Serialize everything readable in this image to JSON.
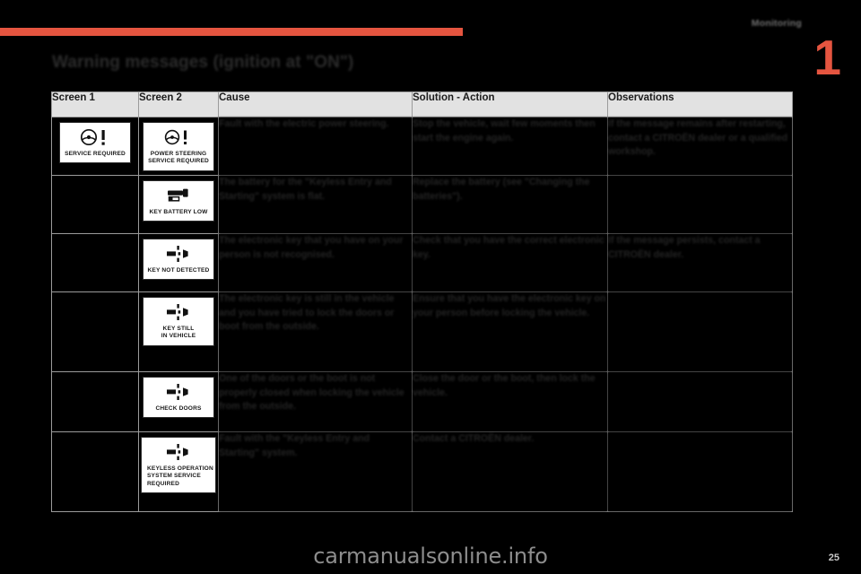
{
  "document": {
    "chapter_number": "1",
    "chapter_tab_label": "Monitoring",
    "section_title": "Warning messages (ignition at \"ON\")",
    "page_number": "25",
    "watermark": "carmanualsonline.info",
    "accent_color": "#e55540"
  },
  "table": {
    "headers": [
      "Screen 1",
      "Screen 2",
      "Cause",
      "Solution - Action",
      "Observations"
    ],
    "rows": [
      {
        "screen1": {
          "icon": "steering-wheel-warning-icon",
          "caption": "SERVICE REQUIRED"
        },
        "screen2": {
          "icon": "steering-wheel-warning-icon",
          "caption": "POWER STEERING\nSERVICE REQUIRED"
        },
        "cause": "Fault with the electric power steering.",
        "solution": "Stop the vehicle, wait few moments then start the engine again.",
        "observations": "If the message remains after restarting, contact a CITROËN dealer or a qualified workshop."
      },
      {
        "screen1": null,
        "screen2": {
          "icon": "key-battery-icon",
          "caption": "KEY BATTERY LOW"
        },
        "cause": "The battery for the \"Keyless Entry and Starting\" system is flat.",
        "solution": "Replace the battery (see \"Changing the batteries\").",
        "observations": ""
      },
      {
        "screen1": null,
        "screen2": {
          "icon": "key-not-detected-icon",
          "caption": "KEY NOT DETECTED"
        },
        "cause": "The electronic key that you have on your person is not recognised.",
        "solution": "Check that you have the correct electronic key.",
        "observations": "If the message persists, contact a CITROËN dealer."
      },
      {
        "screen1": null,
        "screen2": {
          "icon": "key-in-vehicle-icon",
          "caption": "KEY STILL\nIN VEHICLE"
        },
        "cause": "The electronic key is still in the vehicle and you have tried to lock the doors or boot from the outside.",
        "solution": "Ensure that you have the electronic key on your person before locking the vehicle.",
        "observations": ""
      },
      {
        "screen1": null,
        "screen2": {
          "icon": "check-doors-icon",
          "caption": "CHECK DOORS"
        },
        "cause": "One of the doors or the boot is not properly closed when locking the vehicle from the outside.",
        "solution": "Close the door or the boot, then lock the vehicle.",
        "observations": ""
      },
      {
        "screen1": null,
        "screen2": {
          "icon": "keyless-operation-service-icon",
          "caption": "KEYLESS OPERATION\nSYSTEM SERVICE\nREQUIRED"
        },
        "cause": "Fault with the \"Keyless Entry and Starting\" system.",
        "solution": "Contact a CITROËN dealer.",
        "observations": ""
      }
    ]
  }
}
